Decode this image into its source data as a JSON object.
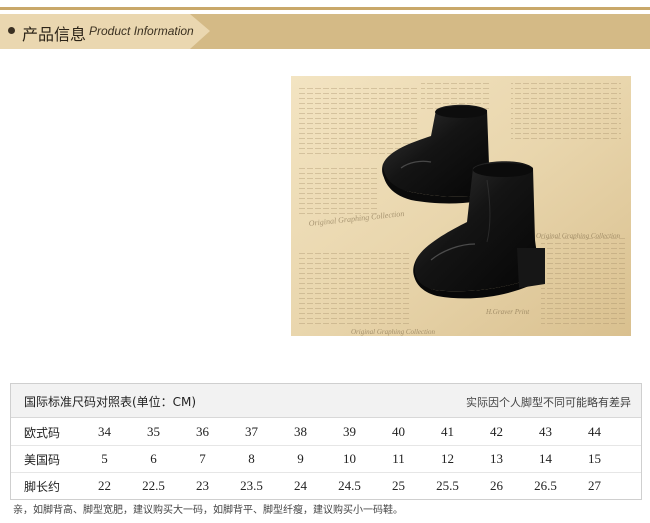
{
  "header": {
    "title_cn": "产品信息",
    "title_en": "Product Information"
  },
  "photo": {
    "subject": "black leather ankle boots on newspaper background",
    "newspaper_texts": [
      "Original Graphing Collection",
      "H.Graver Print"
    ]
  },
  "size_table": {
    "title": "国际标准尺码对照表(单位：CM)",
    "disclaimer": "实际因个人脚型不同可能略有差异",
    "rows": [
      {
        "label": "欧式码",
        "values": [
          "34",
          "35",
          "36",
          "37",
          "38",
          "39",
          "40",
          "41",
          "42",
          "43",
          "44"
        ]
      },
      {
        "label": "美国码",
        "values": [
          "5",
          "6",
          "7",
          "8",
          "9",
          "10",
          "11",
          "12",
          "13",
          "14",
          "15"
        ]
      },
      {
        "label": "脚长约",
        "values": [
          "22",
          "22.5",
          "23",
          "23.5",
          "24",
          "24.5",
          "25",
          "25.5",
          "26",
          "26.5",
          "27"
        ]
      }
    ]
  },
  "note": "亲，如脚背高、脚型宽肥，建议购买大一码，如脚背平、脚型纤瘦，建议购买小一码鞋。",
  "colors": {
    "ribbon_dark": "#d4ba86",
    "ribbon_light": "#ead7b0",
    "table_header_bg": "#f2f2f2"
  }
}
